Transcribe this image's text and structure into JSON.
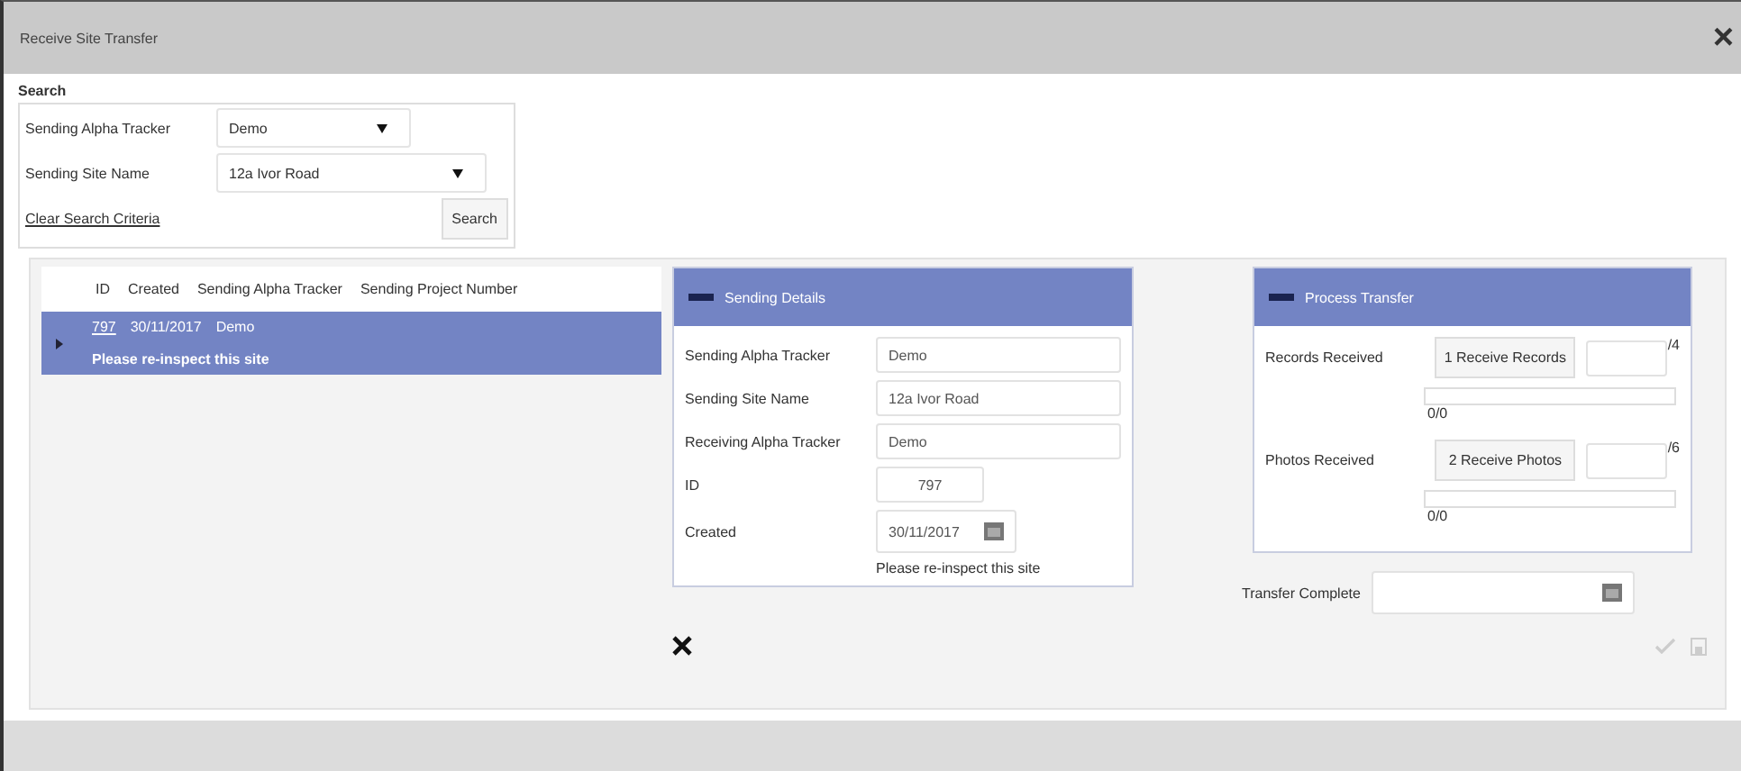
{
  "window": {
    "title": "Receive Site Transfer",
    "close": "×"
  },
  "search": {
    "title": "Search",
    "fields": [
      {
        "label": "Sending Alpha Tracker",
        "value": "Demo"
      },
      {
        "label": "Sending Site Name",
        "value": "12a Ivor Road"
      }
    ],
    "clear_link": "Clear Search Criteria",
    "button": "Search"
  },
  "table": {
    "columns": [
      "ID",
      "Created",
      "Sending Alpha Tracker",
      "Sending Project Number"
    ],
    "rows": [
      {
        "id": "797",
        "created": "30/11/2017",
        "tracker": "Demo",
        "note": "Please re-inspect this site",
        "selected": true
      }
    ]
  },
  "sending_details": {
    "title": "Sending Details",
    "fields": [
      {
        "label": "Sending Alpha Tracker",
        "value": "Demo",
        "kind": "text"
      },
      {
        "label": "Sending Site Name",
        "value": "12a Ivor Road",
        "kind": "text"
      },
      {
        "label": "Receiving Alpha Tracker",
        "value": "Demo",
        "kind": "text"
      },
      {
        "label": "ID",
        "value": "797",
        "kind": "short"
      },
      {
        "label": "Created",
        "value": "30/11/2017",
        "kind": "date"
      }
    ],
    "note": "Please re-inspect this site"
  },
  "process_transfer": {
    "title": "Process Transfer",
    "rows": [
      {
        "label": "Records Received",
        "button": "1 Receive Records",
        "suffix": "/4",
        "level": 0,
        "progress_text": "0/0"
      },
      {
        "label": "Photos Received",
        "button": "2 Receive Photos",
        "suffix": "/6",
        "level": 0,
        "progress_text": "0/0"
      }
    ]
  },
  "transfer_complete": {
    "label": "Transfer Complete"
  }
}
